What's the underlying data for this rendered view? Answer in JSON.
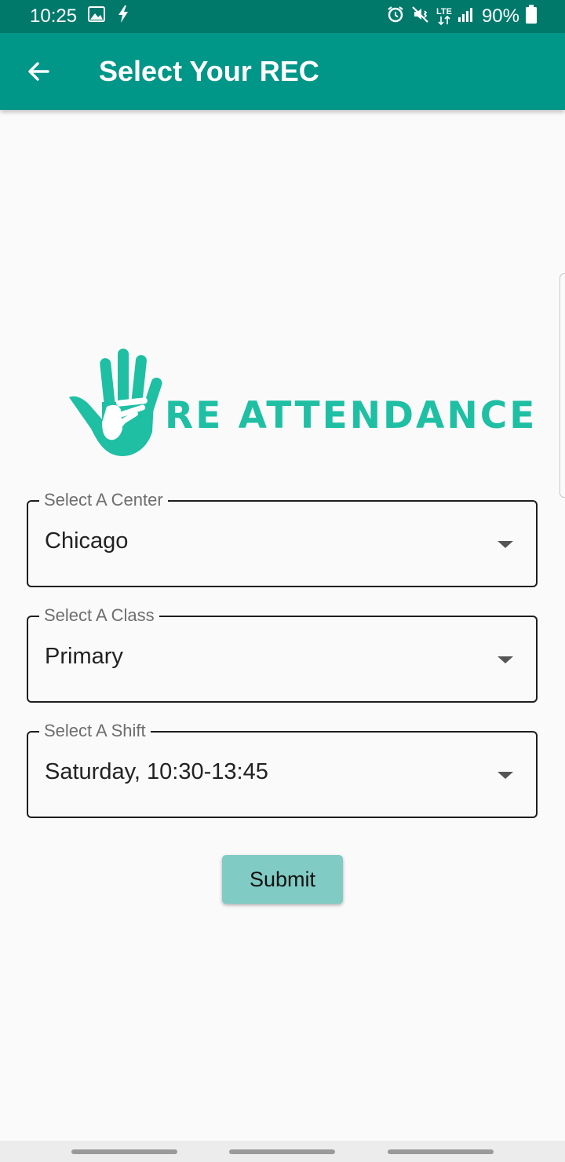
{
  "status_bar": {
    "time": "10:25",
    "network": "LTE",
    "battery": "90%",
    "left_icons": [
      "image-icon",
      "flash-icon"
    ],
    "right_icons": [
      "alarm-icon",
      "mute-vibrate-icon",
      "lte-icon",
      "signal-icon",
      "battery-icon"
    ]
  },
  "app_bar": {
    "title": "Select Your REC",
    "back_icon": "arrow-back-icon",
    "background": "#009688",
    "status_background": "#00796b"
  },
  "logo": {
    "text": "RE ATTENDANCE",
    "icon": "hands-icon",
    "color": "#1fbfa4"
  },
  "form": {
    "center": {
      "label": "Select A Center",
      "value": "Chicago"
    },
    "class": {
      "label": "Select A Class",
      "value": "Primary"
    },
    "shift": {
      "label": "Select A Shift",
      "value": "Saturday, 10:30-13:45"
    },
    "submit_label": "Submit",
    "submit_color": "#80cbc4"
  },
  "nav_bar": {
    "handles": [
      "nav-handle-left",
      "nav-handle-center",
      "nav-handle-right"
    ]
  }
}
